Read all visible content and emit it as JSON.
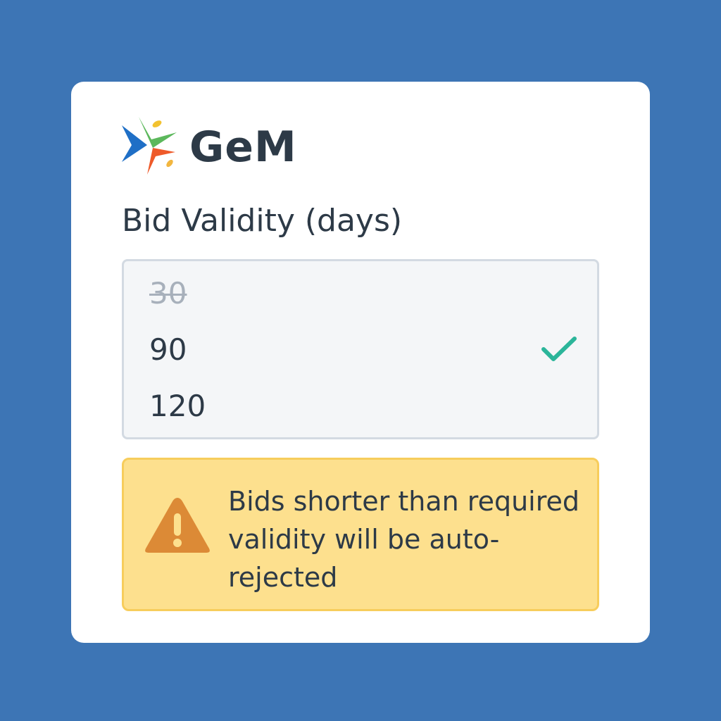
{
  "brand": {
    "name": "GeM",
    "logo_icon": "gem-logo-icon"
  },
  "field": {
    "label": "Bid Validity (days)",
    "options": [
      {
        "label": "30",
        "state": "disabled"
      },
      {
        "label": "90",
        "state": "selected"
      },
      {
        "label": "120",
        "state": "available"
      }
    ],
    "selected_icon": "checkmark-icon"
  },
  "alert": {
    "icon": "warning-icon",
    "message": "Bids shorter than required validity will be auto-rejected"
  },
  "colors": {
    "background": "#3d75b5",
    "card": "#ffffff",
    "text": "#2d3a47",
    "disabled_text": "#a7b0bb",
    "check": "#2bb59a",
    "alert_background": "#fde08e",
    "alert_border": "#f7cd5c",
    "warning_icon": "#dc8a36"
  }
}
